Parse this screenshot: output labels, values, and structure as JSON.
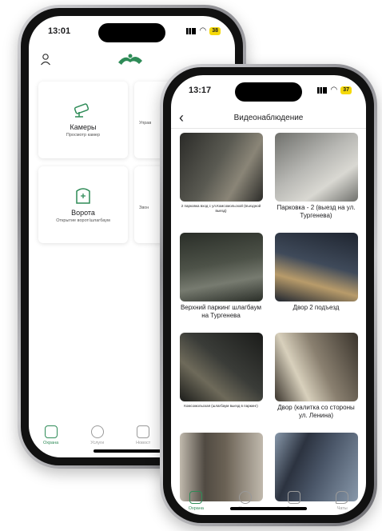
{
  "back_phone": {
    "status_time": "13:01",
    "battery": "38",
    "tiles": [
      {
        "title": "Камеры",
        "subtitle": "Просмотр камер"
      },
      {
        "title": "",
        "subtitle": "Управ"
      },
      {
        "title": "Ворота",
        "subtitle": "Открытие ворот/шлагбаум"
      },
      {
        "title": "",
        "subtitle": "Звон"
      }
    ],
    "tabs": [
      {
        "label": "Охрана"
      },
      {
        "label": "Услуги"
      },
      {
        "label": "Новост"
      }
    ]
  },
  "front_phone": {
    "status_time": "13:17",
    "battery": "37",
    "title": "Видеонаблюдение",
    "cameras": [
      {
        "label": "2 парковка вход с ул.Комсомольской (въездной выезд)",
        "small": true,
        "colors": [
          "#5a5a52",
          "#2b2b28",
          "#8a8577"
        ]
      },
      {
        "label": "Парковка - 2 (выезд на ул. Тургенева)",
        "small": false,
        "colors": [
          "#b8b8b4",
          "#6f706c",
          "#d9d8d2"
        ]
      },
      {
        "label": "Верхний паркинг шлагбаум на Тургенева",
        "small": false,
        "colors": [
          "#4d5248",
          "#2a2e28",
          "#777b70"
        ]
      },
      {
        "label": "Двор 2 подъезд",
        "small": false,
        "colors": [
          "#3f4a5a",
          "#1f2530",
          "#b89b6a"
        ]
      },
      {
        "label": "Комсомольская (шлагбаум выезд в паркинг)",
        "small": true,
        "colors": [
          "#3a3c38",
          "#1b1c1a",
          "#6e6a5a"
        ]
      },
      {
        "label": "Двор (калитка со стороны ул. Ленина)",
        "small": false,
        "colors": [
          "#8a8070",
          "#3a342c",
          "#d8d0bc"
        ]
      },
      {
        "label": "",
        "small": false,
        "colors": [
          "#6b6255",
          "#c0b9ad",
          "#504a42"
        ]
      },
      {
        "label": "",
        "small": false,
        "colors": [
          "#4a5668",
          "#8898aa",
          "#2c3340"
        ]
      }
    ],
    "tabs": [
      {
        "label": "Охрана"
      },
      {
        "label": "Услуги"
      },
      {
        "label": "Заявки"
      },
      {
        "label": "Чаты"
      }
    ]
  },
  "colors": {
    "accent": "#2e8b57",
    "battery": "#f5d90a"
  }
}
